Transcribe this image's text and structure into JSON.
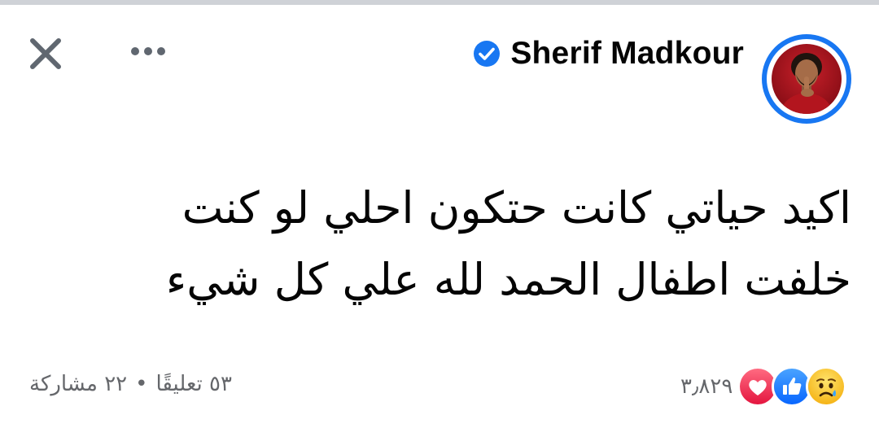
{
  "header": {
    "author_name": "Sherif Madkour",
    "verified": true,
    "accent_color": "#1877f2"
  },
  "icons": {
    "close": "close-icon",
    "more": "more-options-icon",
    "verified": "verified-check-icon",
    "avatar": "profile-photo"
  },
  "post": {
    "line1": "اكيد حياتي كانت حتكون احلي لو كنت",
    "line2": "خلفت اطفال الحمد لله علي كل شيء"
  },
  "footer": {
    "reaction_count": "٣٫٨٢٩",
    "reactions": [
      "love",
      "like",
      "sad"
    ],
    "comments": "٥٣ تعليقًا",
    "separator": "•",
    "shares": "٢٢ مشاركة"
  }
}
